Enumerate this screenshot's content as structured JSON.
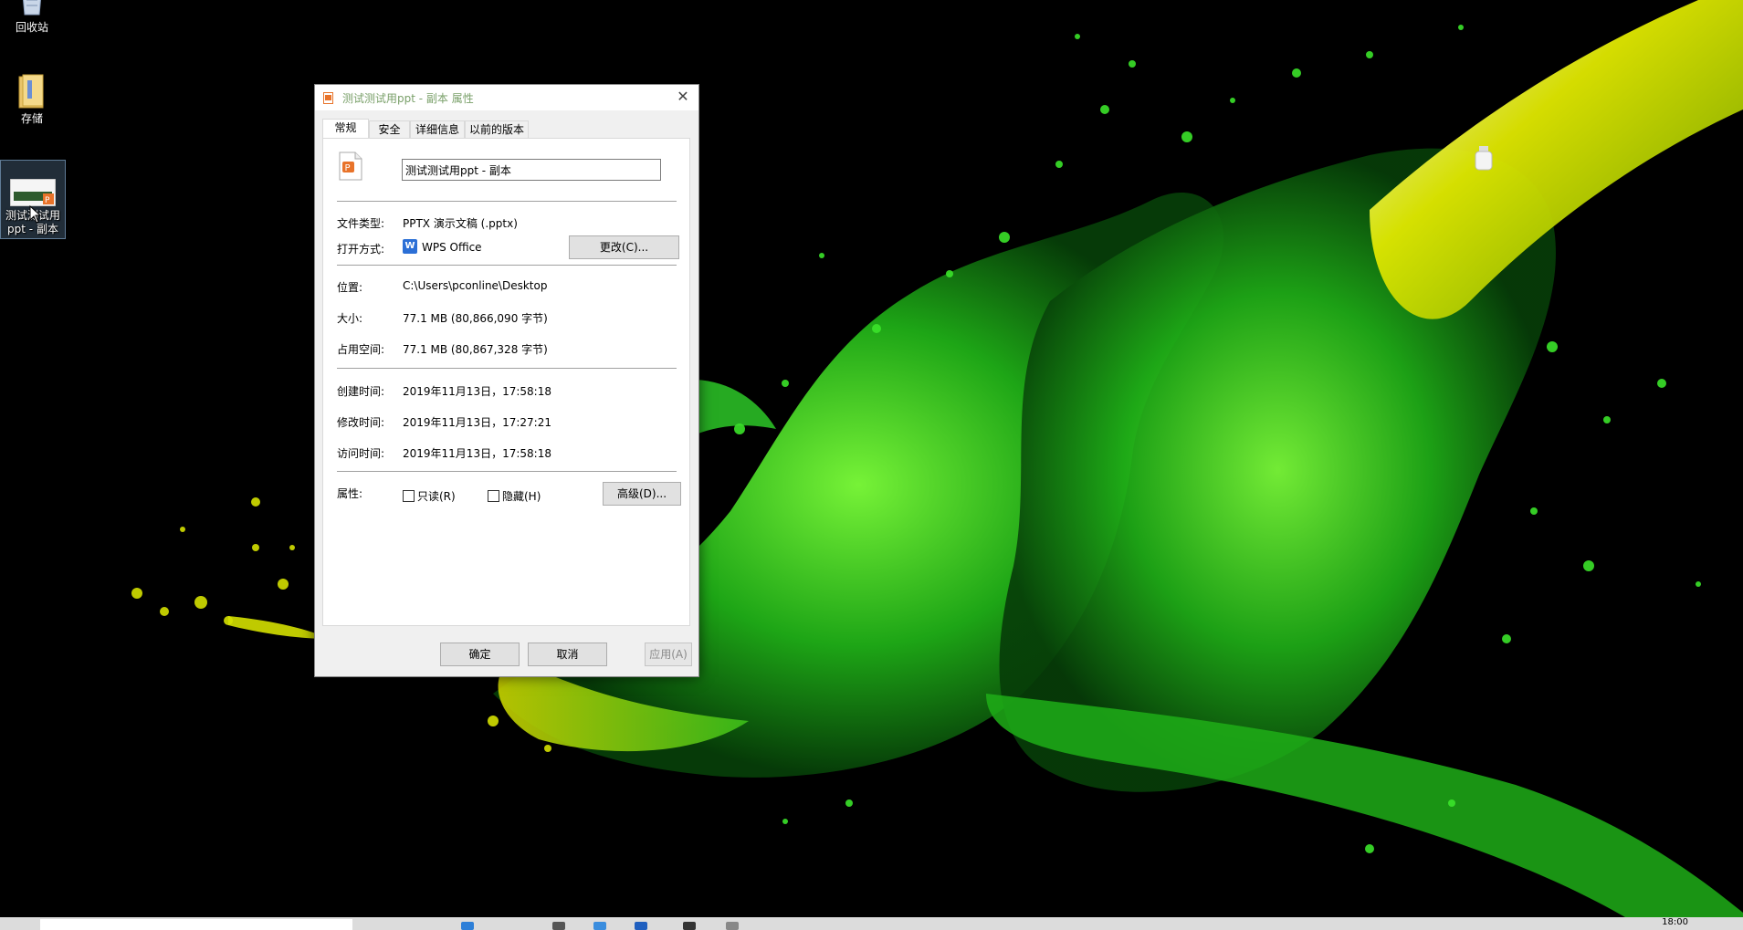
{
  "desktop": {
    "icons": [
      {
        "label": "回收站"
      },
      {
        "label": "存储"
      },
      {
        "label_line1": "测试测试用",
        "label_line2": "ppt - 副本"
      }
    ]
  },
  "dialog": {
    "title": "测试测试用ppt - 副本 属性",
    "close_glyph": "✕",
    "tabs": [
      "常规",
      "安全",
      "详细信息",
      "以前的版本"
    ],
    "file_name": "测试测试用ppt - 副本",
    "fields": {
      "file_type_label": "文件类型:",
      "file_type_value": "PPTX 演示文稿 (.pptx)",
      "open_with_label": "打开方式:",
      "open_with_value": "WPS Office",
      "change_button": "更改(C)...",
      "location_label": "位置:",
      "location_value": "C:\\Users\\pconline\\Desktop",
      "size_label": "大小:",
      "size_value": "77.1 MB (80,866,090 字节)",
      "disk_size_label": "占用空间:",
      "disk_size_value": "77.1 MB (80,867,328 字节)",
      "created_label": "创建时间:",
      "created_value": "2019年11月13日，17:58:18",
      "modified_label": "修改时间:",
      "modified_value": "2019年11月13日，17:27:21",
      "accessed_label": "访问时间:",
      "accessed_value": "2019年11月13日，17:58:18",
      "attributes_label": "属性:",
      "readonly_label": "只读(R)",
      "hidden_label": "隐藏(H)",
      "advanced_button": "高级(D)..."
    },
    "buttons": {
      "ok": "确定",
      "cancel": "取消",
      "apply": "应用(A)"
    }
  },
  "taskbar": {
    "clock": "18:00"
  },
  "colors": {
    "title_text": "#7aa06a",
    "wallpaper_green": "#35c81e",
    "wallpaper_yellow": "#d8e000"
  }
}
